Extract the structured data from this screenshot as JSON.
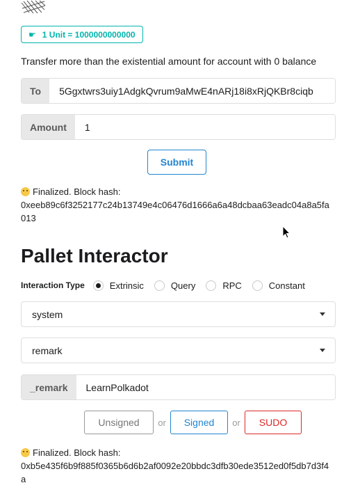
{
  "balances": {
    "unit_label": "1 Unit = 1000000000000",
    "info_text": "Transfer more than the existential amount for account with 0 balance",
    "to_label": "To",
    "to_value": "5Ggxtwrs3uiy1AdgkQvrum9aMwE4nARj18i8xRjQKBr8ciqb",
    "amount_label": "Amount",
    "amount_value": "1",
    "submit_label": "Submit",
    "status_line1": "Finalized. Block hash:",
    "status_hash": "0xeeb89c6f3252177c24b13749e4c06476d1666a6a48dcbaa63eadc04a8a5fa013"
  },
  "pallet_interactor": {
    "title": "Pallet Interactor",
    "interaction_type_label": "Interaction Type",
    "options": [
      {
        "label": "Extrinsic",
        "checked": true
      },
      {
        "label": "Query",
        "checked": false
      },
      {
        "label": "RPC",
        "checked": false
      },
      {
        "label": "Constant",
        "checked": false
      }
    ],
    "pallet_select": "system",
    "callable_select": "remark",
    "param_label": "_remark",
    "param_value": "LearnPolkadot",
    "buttons": {
      "unsigned": "Unsigned",
      "or1": "or",
      "signed": "Signed",
      "or2": "or",
      "sudo": "SUDO"
    },
    "status_line1": "Finalized. Block hash:",
    "status_hash": "0xb5e435f6b9f885f0365b6d6b2af0092e20bbdc3dfb30ede3512ed0f5db7d3f4a"
  },
  "icons": {
    "logo": "polkadot-logo-icon",
    "hand": "hand-pointing-right-icon",
    "emoji": "slightly-smiling-face-icon",
    "caret": "dropdown-caret-icon",
    "cursor": "mouse-pointer-icon"
  },
  "colors": {
    "teal": "#00b5ad",
    "blue": "#2185d0",
    "red": "#db2828"
  }
}
